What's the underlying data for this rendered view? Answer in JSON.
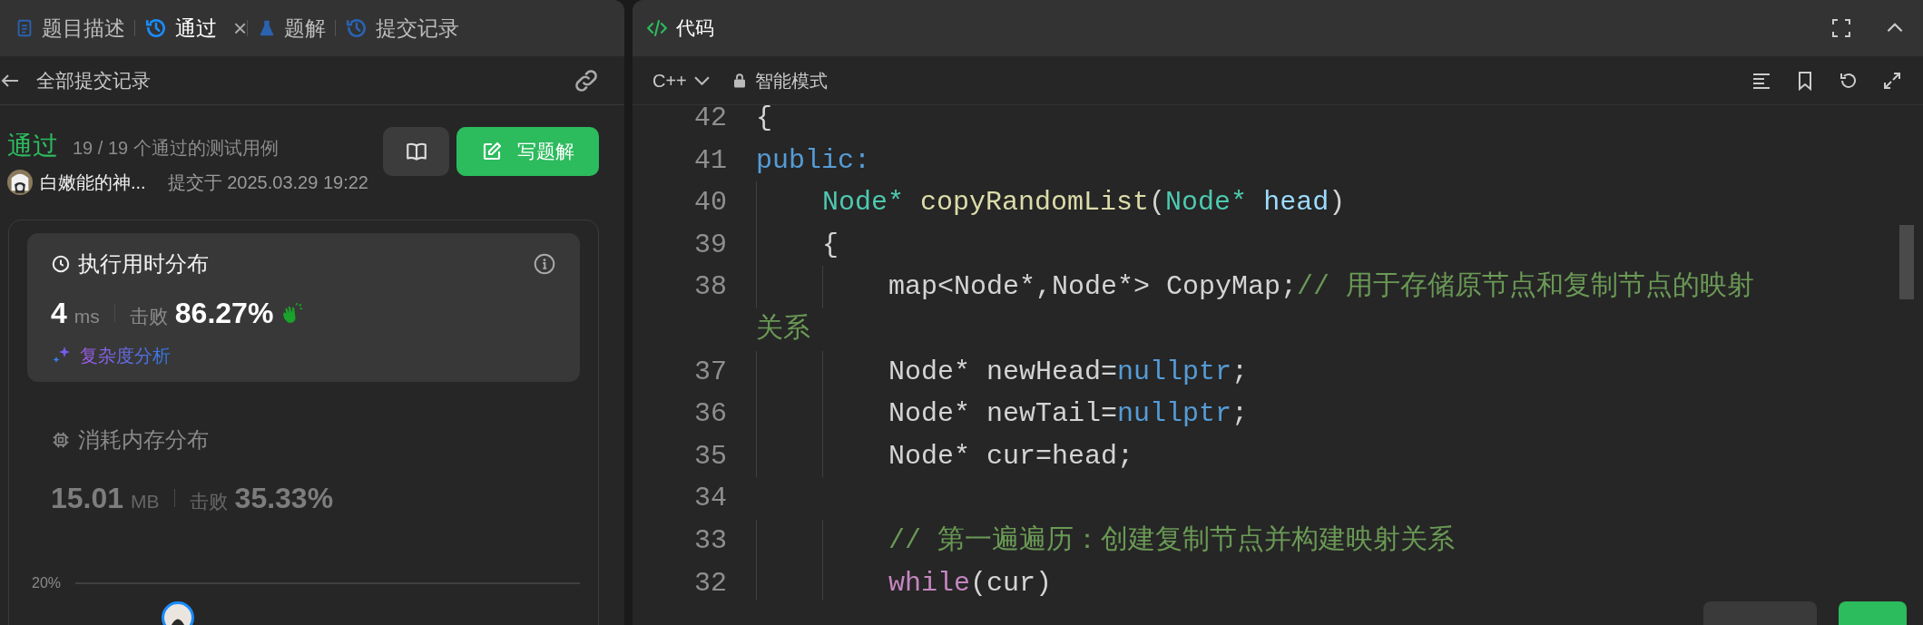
{
  "left_panel": {
    "tabs": [
      {
        "label": "题目描述",
        "kind": "doc",
        "selected": false
      },
      {
        "label": "通过",
        "kind": "history",
        "selected": true,
        "close": "×"
      },
      {
        "label": "题解",
        "kind": "flask",
        "selected": false
      },
      {
        "label": "提交记录",
        "kind": "history",
        "selected": false
      }
    ],
    "header": {
      "title": "全部提交记录"
    },
    "submission": {
      "verdict": "通过",
      "cases": "19 / 19 个通过的测试用例",
      "author": "白嫩能的神...",
      "submitted": "提交于 2025.03.29 19:22",
      "write_button": "写题解"
    },
    "metrics": [
      {
        "kind": "time",
        "title": "执行用时分布",
        "value": "4",
        "unit": "ms",
        "beat_label": "击败",
        "beat": "86.27%",
        "selected": true,
        "analysis": "复杂度分析"
      },
      {
        "kind": "memory",
        "title": "消耗内存分布",
        "value": "15.01",
        "unit": "MB",
        "beat_label": "击败",
        "beat": "35.33%",
        "selected": false
      }
    ],
    "chart": {
      "axis_label": "20%"
    }
  },
  "code_panel": {
    "title": "代码",
    "language": "C++",
    "mode": "智能模式",
    "lines": [
      {
        "number": "42",
        "tokens": [
          {
            "kind": "plain",
            "text": "{"
          }
        ]
      },
      {
        "number": "41",
        "tokens": [
          {
            "kind": "keyword",
            "text": "public:"
          }
        ]
      },
      {
        "number": "40",
        "tokens": [
          {
            "kind": "type",
            "text": "    Node* "
          },
          {
            "kind": "func",
            "text": "copyRandomList"
          },
          {
            "kind": "plain",
            "text": "("
          },
          {
            "kind": "type",
            "text": "Node* "
          },
          {
            "kind": "param",
            "text": "head"
          },
          {
            "kind": "plain",
            "text": ")"
          }
        ]
      },
      {
        "number": "39",
        "tokens": [
          {
            "kind": "plain",
            "text": "    {"
          }
        ]
      },
      {
        "number": "38",
        "tokens": [
          {
            "kind": "plain",
            "text": "        map<Node*,Node*> CopyMap;"
          },
          {
            "kind": "comment",
            "text": "// 用于存储原节点和复制节点的映射"
          }
        ]
      },
      {
        "tokens": [
          {
            "kind": "comment",
            "text": "关系"
          }
        ]
      },
      {
        "number": "37",
        "tokens": [
          {
            "kind": "plain",
            "text": "        Node* newHead="
          },
          {
            "kind": "keyword",
            "text": "nullptr"
          },
          {
            "kind": "plain",
            "text": ";"
          }
        ]
      },
      {
        "number": "36",
        "tokens": [
          {
            "kind": "plain",
            "text": "        Node* newTail="
          },
          {
            "kind": "keyword",
            "text": "nullptr"
          },
          {
            "kind": "plain",
            "text": ";"
          }
        ]
      },
      {
        "number": "35",
        "tokens": [
          {
            "kind": "plain",
            "text": "        Node* cur=head;"
          }
        ]
      },
      {
        "number": "34"
      },
      {
        "number": "33",
        "tokens": [
          {
            "kind": "comment",
            "text": "        // 第一遍遍历：创建复制节点并构建映射关系"
          }
        ]
      },
      {
        "number": "32",
        "tokens": [
          {
            "kind": "control",
            "text": "        while"
          },
          {
            "kind": "plain",
            "text": "(cur)"
          }
        ]
      }
    ]
  }
}
